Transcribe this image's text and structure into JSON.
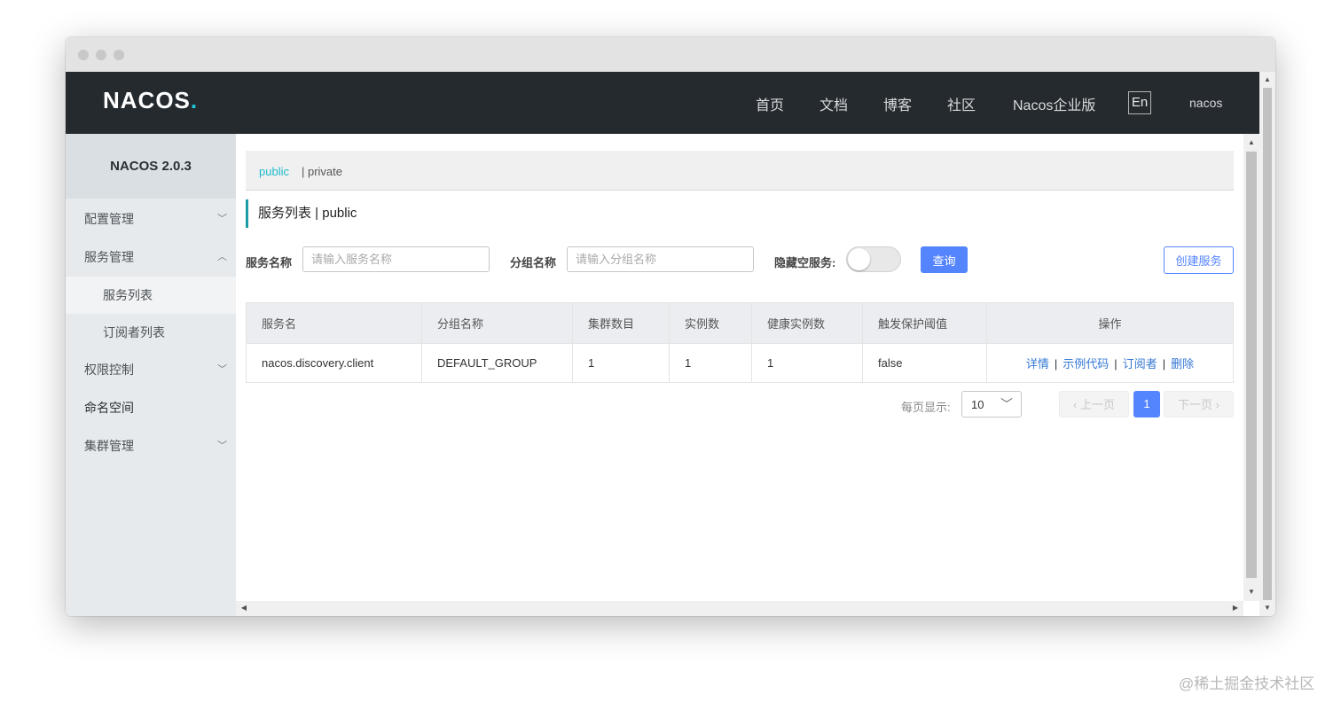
{
  "topnav": {
    "logo": "NACOS",
    "logo_suffix": ".",
    "links": [
      "首页",
      "文档",
      "博客",
      "社区",
      "Nacos企业版"
    ],
    "lang": "En",
    "user": "nacos"
  },
  "sidebar": {
    "version": "NACOS 2.0.3",
    "items": [
      {
        "label": "配置管理",
        "icon": "chevron-down-icon"
      },
      {
        "label": "服务管理",
        "icon": "chevron-up-icon"
      },
      {
        "label": "服务列表",
        "sub": true,
        "active": true
      },
      {
        "label": "订阅者列表",
        "sub": true
      },
      {
        "label": "权限控制",
        "icon": "chevron-down-icon"
      },
      {
        "label": "命名空间"
      },
      {
        "label": "集群管理",
        "icon": "chevron-down-icon"
      }
    ]
  },
  "namespace": {
    "active": "public",
    "other": "| private"
  },
  "page": {
    "title": "服务列表 | public"
  },
  "filters": {
    "service_label": "服务名称",
    "service_placeholder": "请输入服务名称",
    "group_label": "分组名称",
    "group_placeholder": "请输入分组名称",
    "hide_empty_label": "隐藏空服务:",
    "hide_empty": false,
    "query_btn": "查询",
    "create_btn": "创建服务"
  },
  "table": {
    "headers": [
      "服务名",
      "分组名称",
      "集群数目",
      "实例数",
      "健康实例数",
      "触发保护阈值",
      "操作"
    ],
    "rows": [
      {
        "name": "nacos.discovery.client",
        "group": "DEFAULT_GROUP",
        "clusters": "1",
        "instances": "1",
        "healthy": "1",
        "threshold": "false"
      }
    ],
    "ops": [
      "详情",
      "示例代码",
      "订阅者",
      "删除"
    ],
    "op_sep": "|"
  },
  "pagination": {
    "page_size_label": "每页显示:",
    "page_size": "10",
    "prev": "上一页",
    "current": "1",
    "next": "下一页"
  },
  "watermark": "@稀土掘金技术社区",
  "colors": {
    "accent": "#5584ff",
    "namespace_active": "#1cbbcc",
    "nav_bg": "#252a2f",
    "link": "#3478d4"
  }
}
